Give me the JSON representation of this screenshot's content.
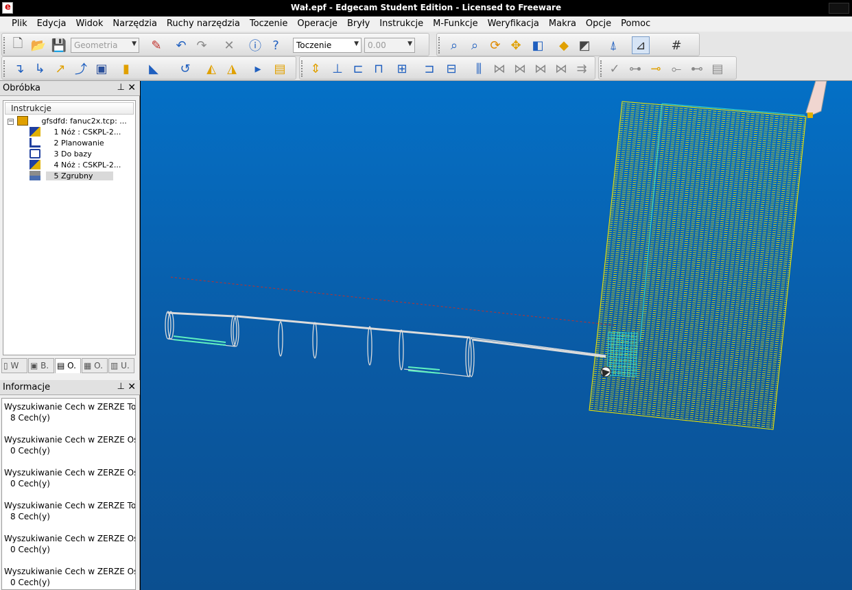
{
  "window": {
    "title": "Wał.epf - Edgecam Student Edition - Licensed to Freeware"
  },
  "menu": {
    "items": [
      "Plik",
      "Edycja",
      "Widok",
      "Narzędzia",
      "Ruchy narzędzia",
      "Toczenie",
      "Operacje",
      "Bryły",
      "Instrukcje",
      "M-Funkcje",
      "Weryfikacja",
      "Makra",
      "Opcje",
      "Pomoc"
    ]
  },
  "toolbar": {
    "layer_combo": "Geometria",
    "mode_combo": "Toczenie",
    "value_combo": "0.00"
  },
  "machining_panel": {
    "title": "Obróbka",
    "column_header": "Instrukcje",
    "root": "gfsdfd: fanuc2x.tcp: ...",
    "items": [
      {
        "label": "1 Nóż : CSKPL-2...",
        "icon": "tool-icon"
      },
      {
        "label": "2 Planowanie",
        "icon": "facing-icon"
      },
      {
        "label": "3 Do bazy",
        "icon": "home-icon"
      },
      {
        "label": "4 Nóż : CSKPL-2...",
        "icon": "tool-icon"
      },
      {
        "label": "5 Zgrubny",
        "icon": "roughing-icon"
      }
    ],
    "selected_index": 4
  },
  "panel_tabs": [
    "W",
    "B.",
    "O.",
    "O.",
    "U."
  ],
  "info_panel": {
    "title": "Informacje",
    "entries": [
      {
        "line": "Wyszukiwanie Cech w ZERZE Toc",
        "count": "8 Cech(y)"
      },
      {
        "line": "Wyszukiwanie Cech w ZERZE Osi",
        "count": "0 Cech(y)"
      },
      {
        "line": "Wyszukiwanie Cech w ZERZE Osi",
        "count": "0 Cech(y)"
      },
      {
        "line": "Wyszukiwanie Cech w ZERZE Toc",
        "count": "8 Cech(y)"
      },
      {
        "line": "Wyszukiwanie Cech w ZERZE Osi",
        "count": "0 Cech(y)"
      },
      {
        "line": "Wyszukiwanie Cech w ZERZE Osi",
        "count": "0 Cech(y)"
      }
    ]
  },
  "colors": {
    "viewport_top": "#0470c6",
    "viewport_bottom": "#0b4f90",
    "toolpath": "#f2e600",
    "toolpath_cyan": "#37e0d0",
    "stock_outline": "#e6e6e6",
    "centerline": "#c0302a"
  }
}
